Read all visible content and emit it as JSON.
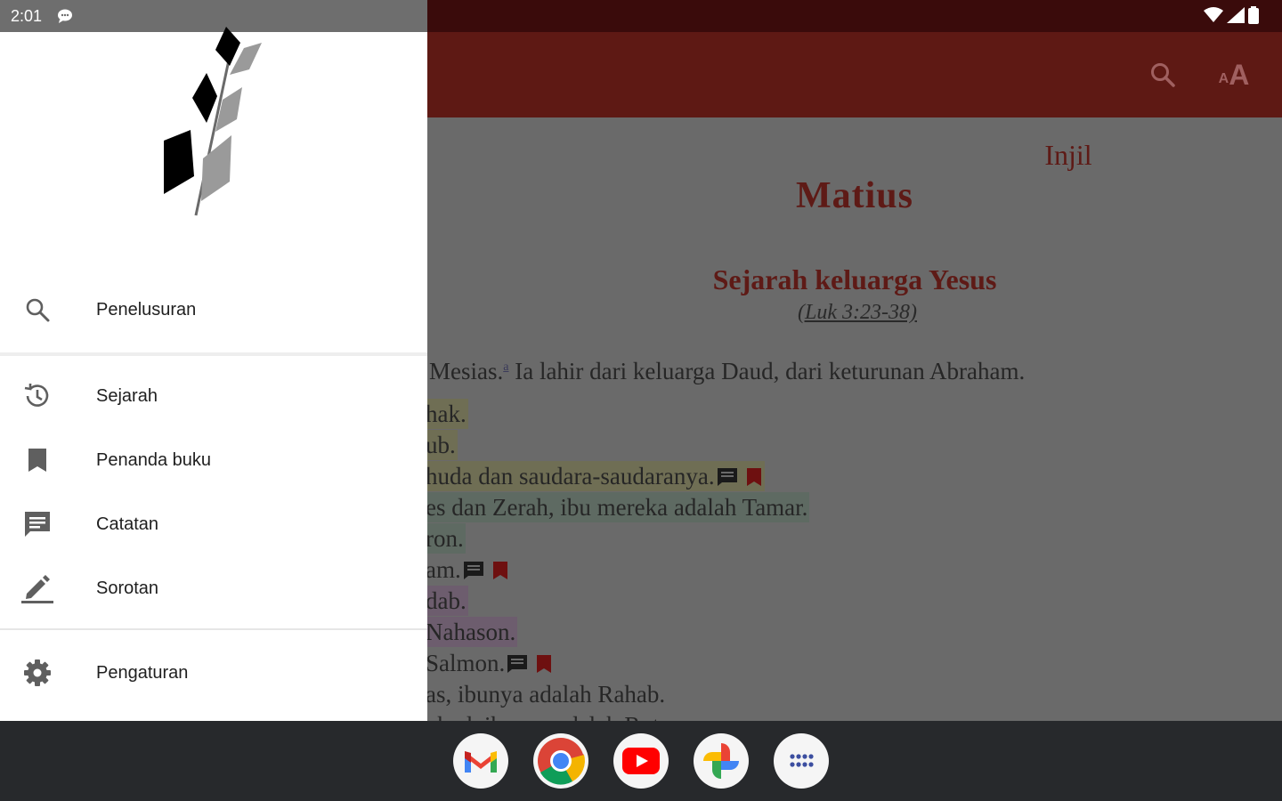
{
  "status_bar": {
    "time": "2:01"
  },
  "app_bar": {
    "font_button_label": "AA"
  },
  "reader": {
    "book_prefix": "Injil",
    "book_name": "Matius",
    "section_heading": "Sejarah keluarga Yesus",
    "section_reference": "(Luk 3:23-38)",
    "verse_intro_before": "Mesias.",
    "verse_intro_footnote": "a",
    "verse_intro_after": " Ia lahir dari keluarga Daud, dari keturunan Abraham.",
    "lines": [
      {
        "text": "hak.",
        "highlight": "yellow",
        "note": false,
        "bookmark": false
      },
      {
        "text": "ub.",
        "highlight": "yellow",
        "note": false,
        "bookmark": false
      },
      {
        "text": "huda dan saudara-saudaranya.",
        "highlight": "yellow",
        "note": true,
        "bookmark": true
      },
      {
        "text": "es dan Zerah, ibu mereka adalah Tamar.",
        "highlight": "green",
        "note": false,
        "bookmark": false
      },
      {
        "text": "ron.",
        "highlight": "green",
        "note": false,
        "bookmark": false
      },
      {
        "text": "am.",
        "highlight": "none",
        "note": true,
        "bookmark": true
      },
      {
        "text": "dab.",
        "highlight": "purple",
        "note": false,
        "bookmark": false
      },
      {
        "text": " Nahason.",
        "highlight": "purple",
        "note": false,
        "bookmark": false
      },
      {
        "text": "Salmon.",
        "highlight": "none",
        "note": true,
        "bookmark": true
      },
      {
        "text": "as, ibunya adalah Rahab.",
        "highlight": "none",
        "note": false,
        "bookmark": false
      },
      {
        "text": "obed, ibunya adalah Rut.",
        "highlight": "none",
        "note": false,
        "bookmark": false
      }
    ]
  },
  "drawer": {
    "items": [
      {
        "label": "Penelusuran",
        "icon": "search-icon"
      },
      {
        "label": "Sejarah",
        "icon": "history-icon"
      },
      {
        "label": "Penanda buku",
        "icon": "bookmark-icon"
      },
      {
        "label": "Catatan",
        "icon": "note-icon"
      },
      {
        "label": "Sorotan",
        "icon": "highlight-pen-icon"
      },
      {
        "label": "Pengaturan",
        "icon": "gear-icon"
      }
    ]
  },
  "taskbar": {
    "apps": [
      "gmail-icon",
      "chrome-icon",
      "youtube-icon",
      "photos-icon",
      "app-drawer-icon"
    ]
  },
  "colors": {
    "app_bar": "#5e1914",
    "status_bar": "#3a0b0b",
    "title_red": "#5e1a16",
    "scrim_content": "#6a6a6a",
    "taskbar": "#27292c"
  }
}
